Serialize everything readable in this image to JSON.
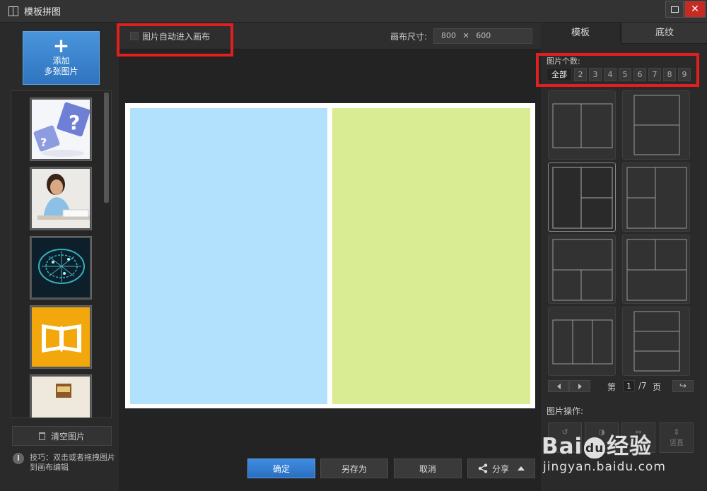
{
  "window": {
    "title": "模板拼图",
    "icons": {
      "app": "layout-icon",
      "maximize": "maximize-icon",
      "close": "close-icon"
    }
  },
  "left": {
    "add_button": {
      "plus": "+",
      "line1": "添加",
      "line2": "多张图片"
    },
    "thumbnails": [
      {
        "name": "question-dice-thumbnail"
      },
      {
        "name": "girl-studying-thumbnail"
      },
      {
        "name": "digital-brain-thumbnail"
      },
      {
        "name": "open-book-thumbnail"
      },
      {
        "name": "partial-thumbnail"
      }
    ],
    "clear_button": "清空图片",
    "tip_icon": "i",
    "tip_text": "技巧：双击或者拖拽图片到画布编辑"
  },
  "center": {
    "auto_enter_label": "图片自动进入画布",
    "canvas_size_label": "画布尺寸:",
    "canvas_width": "800",
    "canvas_times": "✕",
    "canvas_height": "600",
    "cells": [
      "#b1e1fc",
      "#d9ec93"
    ],
    "buttons": {
      "ok": "确定",
      "save_as": "另存为",
      "cancel": "取消",
      "share": "分享"
    }
  },
  "right": {
    "tabs": [
      "模板",
      "底纹"
    ],
    "count_label": "图片个数:",
    "counts": [
      "全部",
      "2",
      "3",
      "4",
      "5",
      "6",
      "7",
      "8",
      "9"
    ],
    "pager": {
      "prefix": "第",
      "page": "1",
      "total": "/7",
      "suffix": "页",
      "return": "↪"
    },
    "ops_label": "图片操作:",
    "ops_partial": "竖直"
  },
  "watermark": {
    "brand": "Bai",
    "paw": "du",
    "brand_cn": "经验",
    "url": "jingyan.baidu.com"
  },
  "colors": {
    "accent": "#2f74bf",
    "highlight": "#e02020",
    "close": "#c62a23"
  }
}
